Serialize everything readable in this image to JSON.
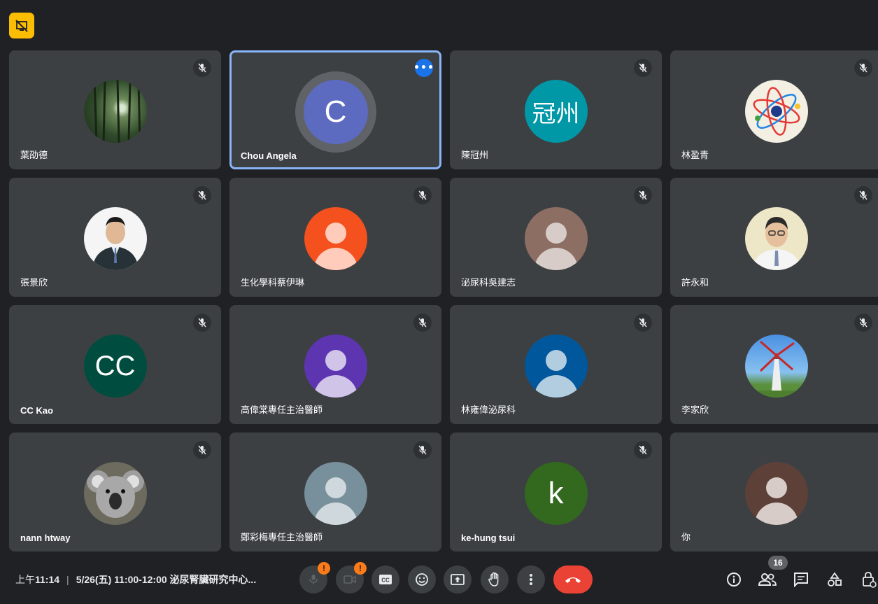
{
  "meeting": {
    "time_prefix": "上午",
    "time": "11:14",
    "title": "5/26(五) 11:00-12:00 泌尿腎臟研究中心...",
    "participant_count": "16"
  },
  "tiles": [
    {
      "name": "葉劭德",
      "avatar": "photo-forest",
      "muted": true
    },
    {
      "name": "Chou Angela",
      "avatar_letter": "C",
      "avatar_color": "#5c6bc0",
      "active": true
    },
    {
      "name": "陳冠州",
      "avatar_letter": "冠州",
      "avatar_color": "#0097a7",
      "muted": true
    },
    {
      "name": "林盈青",
      "avatar": "photo-atom",
      "muted": true
    },
    {
      "name": "張景欣",
      "avatar": "photo-man-suit",
      "muted": true
    },
    {
      "name": "生化學科蔡伊琳",
      "avatar": "person-placeholder",
      "avatar_color": "#f4511e",
      "muted": true
    },
    {
      "name": "泌尿科吳建志",
      "avatar": "person-placeholder",
      "avatar_color": "#8d6e63",
      "muted": true
    },
    {
      "name": "許永和",
      "avatar": "photo-man-glasses",
      "muted": true
    },
    {
      "name": "CC Kao",
      "avatar_letter": "CC",
      "avatar_color": "#004d40",
      "muted": true
    },
    {
      "name": "高偉棠專任主治醫師",
      "avatar": "person-placeholder",
      "avatar_color": "#5e35b1",
      "muted": true
    },
    {
      "name": "林雍偉泌尿科",
      "avatar": "person-placeholder",
      "avatar_color": "#01579b",
      "muted": true
    },
    {
      "name": "李家欣",
      "avatar": "photo-windmill",
      "muted": true
    },
    {
      "name": "nann htway",
      "avatar": "photo-koala",
      "muted": true
    },
    {
      "name": "鄭彩梅專任主治醫師",
      "avatar": "person-placeholder",
      "avatar_color": "#78909c",
      "muted": true
    },
    {
      "name": "ke-hung tsui",
      "avatar_letter": "k",
      "avatar_color": "#33691e",
      "muted": true
    },
    {
      "name": "你",
      "avatar": "person-placeholder",
      "avatar_color": "#5d4037"
    }
  ],
  "controls": [
    "mic-off-icon",
    "camera-off-icon",
    "captions-icon",
    "emoji-icon",
    "present-icon",
    "raise-hand-icon",
    "more-options-icon",
    "end-call-icon"
  ],
  "right_controls": [
    "info-icon",
    "people-icon",
    "chat-icon",
    "activities-icon",
    "host-controls-icon"
  ]
}
